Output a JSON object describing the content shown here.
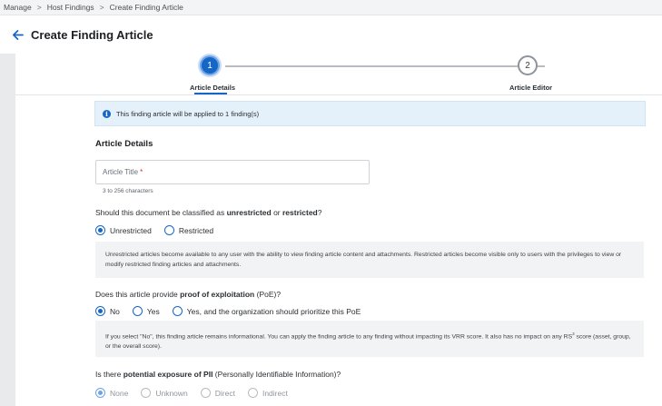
{
  "breadcrumb": {
    "items": [
      "Manage",
      "Host Findings",
      "Create Finding Article"
    ],
    "separator": ">"
  },
  "header": {
    "title": "Create Finding Article"
  },
  "stepper": {
    "steps": [
      {
        "number": "1",
        "label": "Article Details",
        "active": true
      },
      {
        "number": "2",
        "label": "Article Editor",
        "active": false
      }
    ]
  },
  "info_banner": {
    "icon": "info-icon",
    "text": "This finding article will be applied to 1 finding(s)"
  },
  "form": {
    "section_title": "Article Details",
    "title_field": {
      "placeholder": "Article Title",
      "required_mark": "*",
      "helper": "3 to 256 characters"
    },
    "classification": {
      "question_pre": "Should this document be classified as ",
      "question_b1": "unrestricted",
      "question_mid": " or ",
      "question_b2": "restricted",
      "question_post": "?",
      "options": [
        "Unrestricted",
        "Restricted"
      ],
      "selected": "Unrestricted",
      "note": "Unrestricted articles become available to any user with the ability to view finding article content and attachments. Restricted articles become visible only to users with the privileges to view or modify restricted finding articles and attachments."
    },
    "poe": {
      "question_pre": "Does this article provide ",
      "question_b": "proof of exploitation",
      "question_post": " (PoE)?",
      "options": [
        "No",
        "Yes",
        "Yes, and the organization should prioritize this PoE"
      ],
      "selected": "No",
      "note_pre": "If you select \"No\", this finding article remains informational. You can apply the finding article to any finding without impacting its VRR score. It also has no impact on any RS",
      "note_sup": "3",
      "note_post": " score (asset, group, or the overall score)."
    },
    "pii": {
      "question_pre": "Is there ",
      "question_b": "potential exposure of PII",
      "question_post": " (Personally Identifiable Information)?",
      "options": [
        "None",
        "Unknown",
        "Direct",
        "Indirect"
      ],
      "selected": "None"
    }
  },
  "colors": {
    "accent": "#1666c5",
    "banner_bg": "#e4f1fa",
    "note_bg": "#f2f3f4"
  }
}
